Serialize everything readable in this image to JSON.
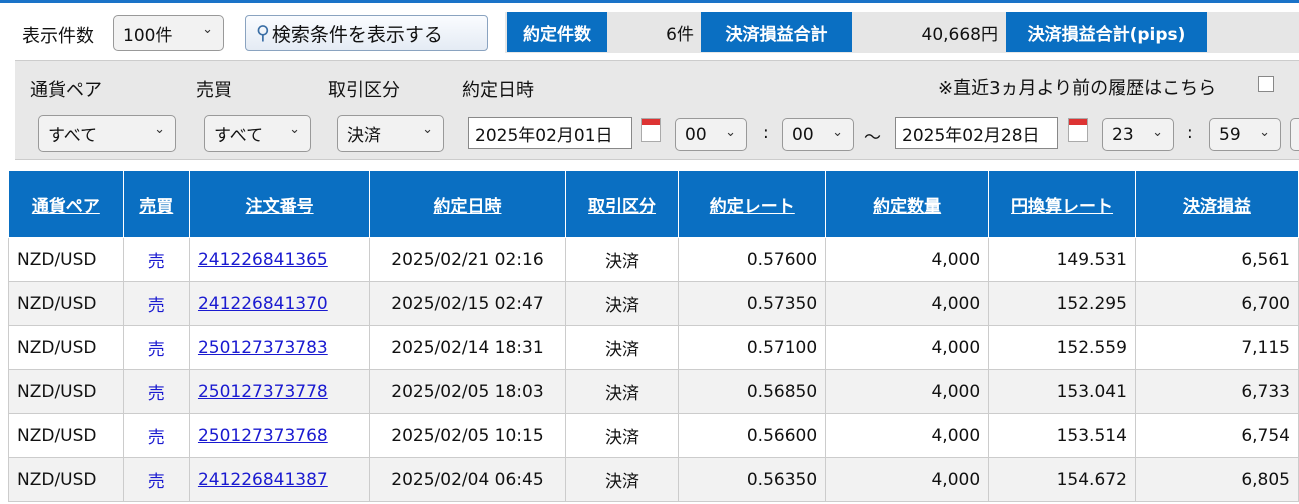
{
  "toolbar": {
    "count_label": "表示件数",
    "count_value": "100件",
    "search_toggle": "検索条件を表示する"
  },
  "summary": {
    "trades_label": "約定件数",
    "trades_value": "6件",
    "pl_label": "決済損益合計",
    "pl_value": "40,668円",
    "pips_label": "決済損益合計(pips)",
    "pips_value": ""
  },
  "filters": {
    "pair_label": "通貨ペア",
    "pair_value": "すべて",
    "side_label": "売買",
    "side_value": "すべて",
    "type_label": "取引区分",
    "type_value": "決済",
    "date_label": "約定日時",
    "from_date": "2025年02月01日",
    "from_hour": "00",
    "from_min": "00",
    "tilde": "～",
    "to_date": "2025年02月28日",
    "to_hour": "23",
    "to_min": "59",
    "colon": ":",
    "history_link": "※直近3ヵ月より前の履歴はこちら"
  },
  "table": {
    "headers": [
      "通貨ペア",
      "売買",
      "注文番号",
      "約定日時",
      "取引区分",
      "約定レート",
      "約定数量",
      "円換算レート",
      "決済損益"
    ],
    "rows": [
      [
        "NZD/USD",
        "売",
        "241226841365",
        "2025/02/21 02:16",
        "決済",
        "0.57600",
        "4,000",
        "149.531",
        "6,561"
      ],
      [
        "NZD/USD",
        "売",
        "241226841370",
        "2025/02/15 02:47",
        "決済",
        "0.57350",
        "4,000",
        "152.295",
        "6,700"
      ],
      [
        "NZD/USD",
        "売",
        "250127373783",
        "2025/02/14 18:31",
        "決済",
        "0.57100",
        "4,000",
        "152.559",
        "7,115"
      ],
      [
        "NZD/USD",
        "売",
        "250127373778",
        "2025/02/05 18:03",
        "決済",
        "0.56850",
        "4,000",
        "153.041",
        "6,733"
      ],
      [
        "NZD/USD",
        "売",
        "250127373768",
        "2025/02/05 10:15",
        "決済",
        "0.56600",
        "4,000",
        "153.514",
        "6,754"
      ],
      [
        "NZD/USD",
        "売",
        "241226841387",
        "2025/02/04 06:45",
        "決済",
        "0.56350",
        "4,000",
        "154.672",
        "6,805"
      ]
    ]
  }
}
